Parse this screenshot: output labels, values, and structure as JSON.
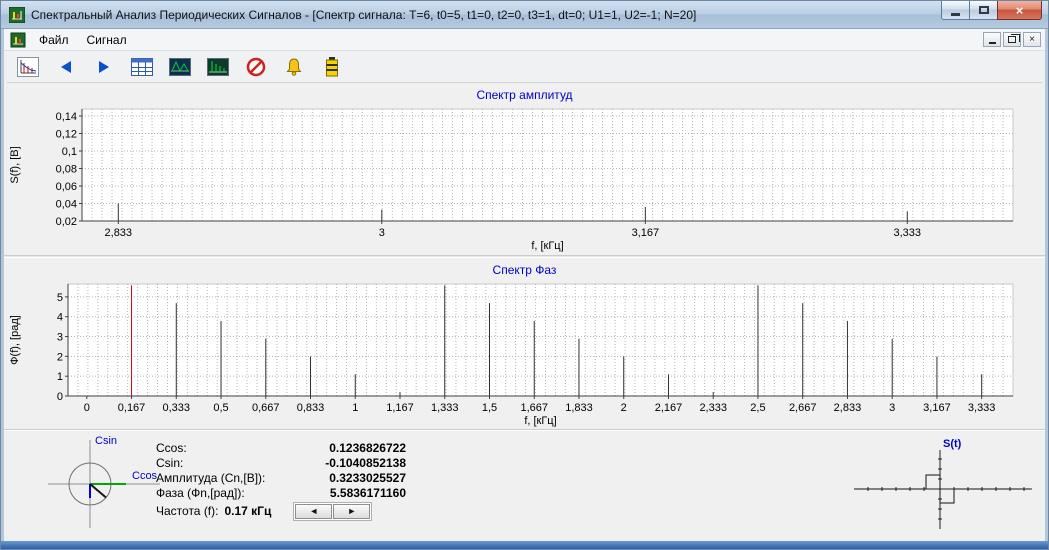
{
  "window": {
    "title": "Спектральный Анализ Периодических Сигналов - [Спектр сигнала: T=6, t0=5, t1=0, t2=0, t3=1, dt=0; U1=1, U2=-1; N=20]",
    "controls": {
      "close": "×"
    }
  },
  "menu": {
    "items": [
      {
        "label": "Файл"
      },
      {
        "label": "Сигнал"
      }
    ],
    "mdi_close": "×"
  },
  "toolbar": {
    "icons": [
      "spectrum-chart",
      "prev-arrow",
      "next-arrow",
      "table",
      "signal-image",
      "spectrum-image",
      "stop",
      "alarm-bell",
      "battery"
    ]
  },
  "chart_data": [
    {
      "id": "amplitude",
      "type": "bar",
      "title": "Спектр амплитуд",
      "xlabel": "f, [кГц]",
      "ylabel": "S(f), [В]",
      "xlim": [
        2.81,
        3.4
      ],
      "ylim": [
        0.02,
        0.148
      ],
      "grid": true,
      "yticks": [
        {
          "v": 0.02,
          "label": "0,02"
        },
        {
          "v": 0.04,
          "label": "0,04"
        },
        {
          "v": 0.06,
          "label": "0,06"
        },
        {
          "v": 0.08,
          "label": "0,08"
        },
        {
          "v": 0.1,
          "label": "0,1"
        },
        {
          "v": 0.12,
          "label": "0,12"
        },
        {
          "v": 0.14,
          "label": "0,14"
        }
      ],
      "xticks": [
        {
          "v": 2.833,
          "label": "2,833"
        },
        {
          "v": 3,
          "label": "3"
        },
        {
          "v": 3.167,
          "label": "3,167"
        },
        {
          "v": 3.333,
          "label": "3,333"
        }
      ],
      "points": [
        {
          "x": 2.833,
          "y": 0.04
        },
        {
          "x": 3.0,
          "y": 0.033
        },
        {
          "x": 3.167,
          "y": 0.036
        },
        {
          "x": 3.333,
          "y": 0.031
        }
      ]
    },
    {
      "id": "phase",
      "type": "bar",
      "title": "Спектр Фаз",
      "xlabel": "f, [кГц]",
      "ylabel": "Ф(f), [рад]",
      "xlim": [
        -0.07,
        3.45
      ],
      "ylim": [
        0,
        5.65
      ],
      "grid": true,
      "yticks": [
        {
          "v": 0,
          "label": "0"
        },
        {
          "v": 1,
          "label": "1"
        },
        {
          "v": 2,
          "label": "2"
        },
        {
          "v": 3,
          "label": "3"
        },
        {
          "v": 4,
          "label": "4"
        },
        {
          "v": 5,
          "label": "5"
        }
      ],
      "xticks": [
        {
          "v": 0,
          "label": "0"
        },
        {
          "v": 0.1667,
          "label": "0,167"
        },
        {
          "v": 0.3333,
          "label": "0,333"
        },
        {
          "v": 0.5,
          "label": "0,5"
        },
        {
          "v": 0.6667,
          "label": "0,667"
        },
        {
          "v": 0.8333,
          "label": "0,833"
        },
        {
          "v": 1,
          "label": "1"
        },
        {
          "v": 1.1667,
          "label": "1,167"
        },
        {
          "v": 1.3333,
          "label": "1,333"
        },
        {
          "v": 1.5,
          "label": "1,5"
        },
        {
          "v": 1.6667,
          "label": "1,667"
        },
        {
          "v": 1.8333,
          "label": "1,833"
        },
        {
          "v": 2,
          "label": "2"
        },
        {
          "v": 2.1667,
          "label": "2,167"
        },
        {
          "v": 2.3333,
          "label": "2,333"
        },
        {
          "v": 2.5,
          "label": "2,5"
        },
        {
          "v": 2.6667,
          "label": "2,667"
        },
        {
          "v": 2.8333,
          "label": "2,833"
        },
        {
          "v": 3,
          "label": "3"
        },
        {
          "v": 3.1667,
          "label": "3,167"
        },
        {
          "v": 3.3333,
          "label": "3,333"
        }
      ],
      "points": [
        {
          "x": 0.1667,
          "y": 5.5836,
          "highlight": true
        },
        {
          "x": 0.3333,
          "y": 4.686
        },
        {
          "x": 0.5,
          "y": 3.7884
        },
        {
          "x": 0.6667,
          "y": 2.8908
        },
        {
          "x": 0.8333,
          "y": 1.9932
        },
        {
          "x": 1.0,
          "y": 1.0956
        },
        {
          "x": 1.1667,
          "y": 0.198
        },
        {
          "x": 1.3333,
          "y": 5.5836
        },
        {
          "x": 1.5,
          "y": 4.686
        },
        {
          "x": 1.6667,
          "y": 3.7884
        },
        {
          "x": 1.8333,
          "y": 2.8908
        },
        {
          "x": 2.0,
          "y": 1.9932
        },
        {
          "x": 2.1667,
          "y": 1.0956
        },
        {
          "x": 2.3333,
          "y": 0.198
        },
        {
          "x": 2.5,
          "y": 5.5836
        },
        {
          "x": 2.6667,
          "y": 4.686
        },
        {
          "x": 2.8333,
          "y": 3.7884
        },
        {
          "x": 3.0,
          "y": 2.8908
        },
        {
          "x": 3.1667,
          "y": 1.9932
        },
        {
          "x": 3.3333,
          "y": 1.0956
        }
      ]
    }
  ],
  "readout": {
    "rows": [
      {
        "label": "Ccos:",
        "value": "0.1236826722"
      },
      {
        "label": "Csin:",
        "value": "-0.1040852138"
      },
      {
        "label": "Амплитуда (Cn,[В]):",
        "value": "0.3233025527"
      },
      {
        "label": "Фаза (Фn,[рад]):",
        "value": "5.5836171160"
      }
    ],
    "freq_label": "Частота (f):",
    "freq_value": "0.17 кГц",
    "prev": "◄",
    "next": "►"
  },
  "vector_widget": {
    "sin_label": "Csin",
    "cos_label": "Ccos"
  },
  "signal_widget": {
    "label": "S(t)"
  },
  "colors": {
    "chart_title": "#0000cc",
    "spike": "#303030",
    "highlight": "#d40000",
    "vector_green": "#00a800",
    "vector_blue": "#0000e0"
  }
}
